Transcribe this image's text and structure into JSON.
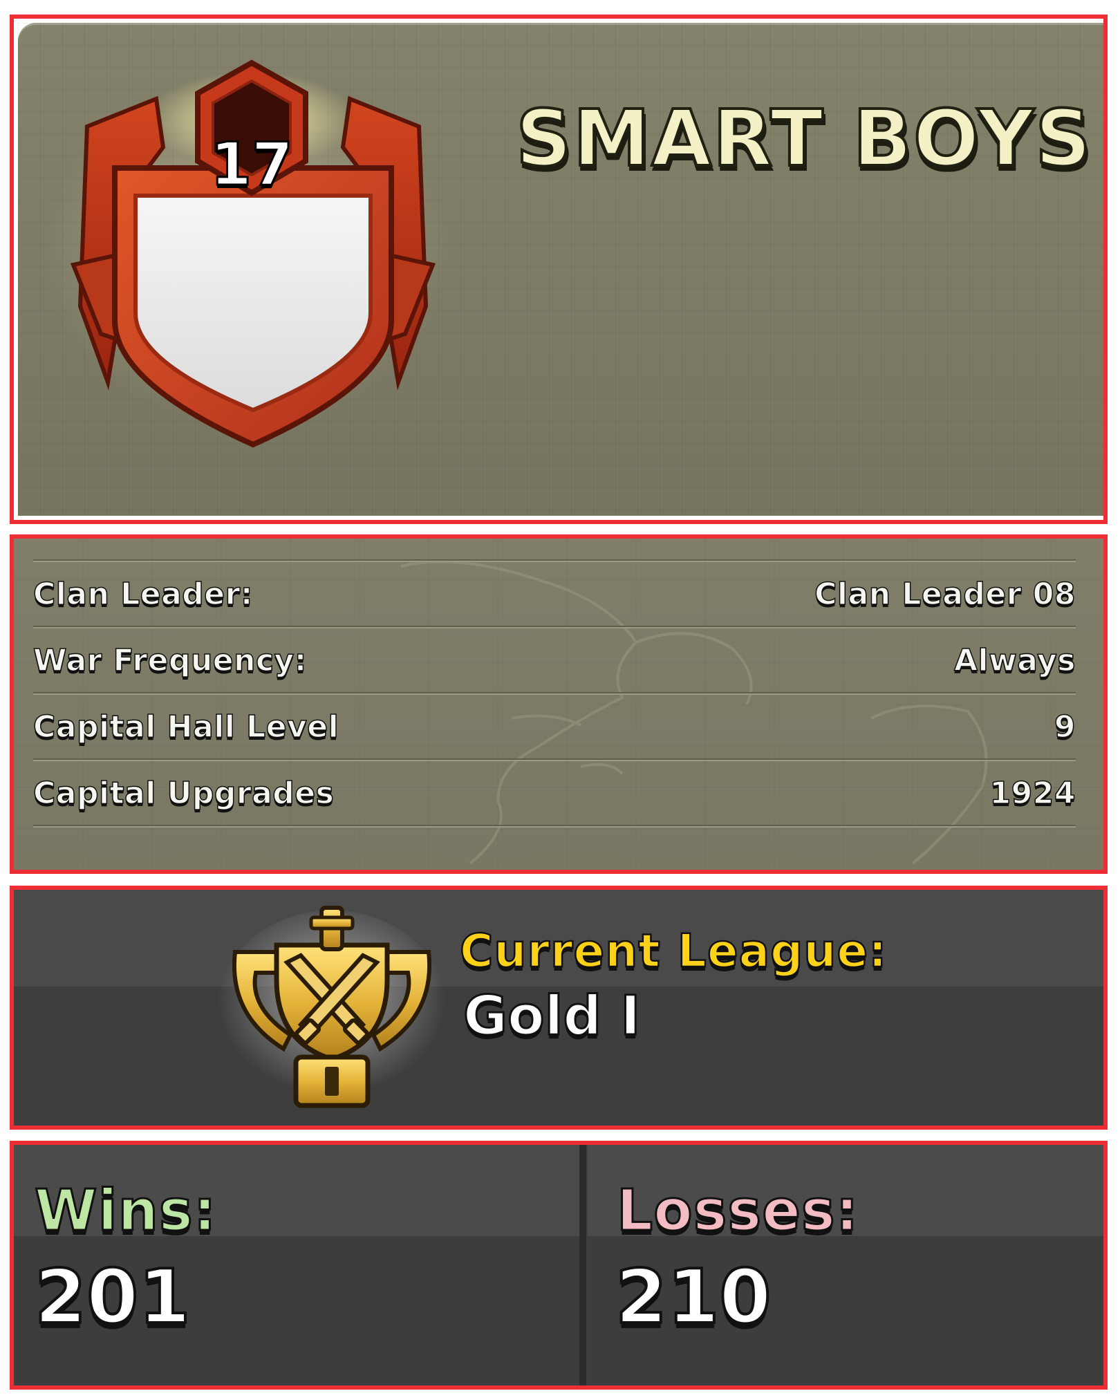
{
  "clan": {
    "name": "SMART BOYS",
    "level": "17"
  },
  "info": {
    "rows": [
      {
        "label": "Clan Leader:",
        "value": "Clan Leader 08"
      },
      {
        "label": "War Frequency:",
        "value": "Always"
      },
      {
        "label": "Capital Hall Level",
        "value": "9"
      },
      {
        "label": "Capital Upgrades",
        "value": "1924"
      }
    ]
  },
  "league": {
    "label": "Current League:",
    "value": "Gold I",
    "icon": "gold-league-trophy-icon"
  },
  "record": {
    "wins_label": "Wins:",
    "wins_value": "201",
    "losses_label": "Losses:",
    "losses_value": "210"
  },
  "colors": {
    "frame_border": "#ee2e34",
    "league_label": "#ffd21a",
    "wins_label": "#bde5a4",
    "losses_label": "#f3bcc3"
  }
}
